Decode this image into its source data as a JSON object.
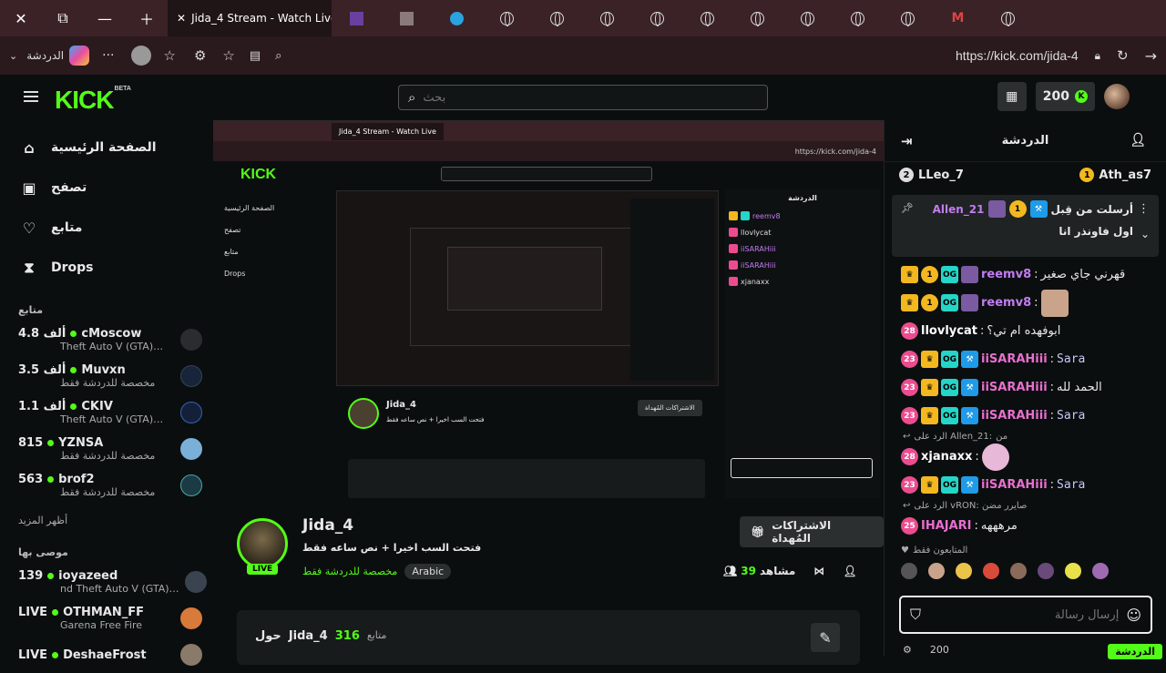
{
  "browser": {
    "active_tab_title": "Jida_4 Stream - Watch Live",
    "url": "https://kick.com/jida-4",
    "chat_label": "الدردشة"
  },
  "header": {
    "logo": "KICK",
    "logo_badge": "BETA",
    "search_placeholder": "بحث",
    "points": "200"
  },
  "sidebar": {
    "nav": [
      {
        "label": "الصفحة الرئيسية",
        "icon": "home-icon"
      },
      {
        "label": "تصفح",
        "icon": "browse-icon"
      },
      {
        "label": "متابع",
        "icon": "heart-icon"
      },
      {
        "label": "Drops",
        "icon": "drops-icon"
      }
    ],
    "following_title": "متابع",
    "following": [
      {
        "count": "4.8 ألف",
        "name": "cMoscow",
        "sub": "Theft Auto V (GTA)…"
      },
      {
        "count": "3.5 ألف",
        "name": "Muvxn",
        "sub": "مخصصة للدردشة فقط"
      },
      {
        "count": "1.1 ألف",
        "name": "CKIV",
        "sub": "Theft Auto V (GTA)…"
      },
      {
        "count": "815",
        "name": "YZNSA",
        "sub": "مخصصة للدردشة فقط"
      },
      {
        "count": "563",
        "name": "brof2",
        "sub": "مخصصة للدردشة فقط"
      }
    ],
    "show_more": "أظهر المزيد",
    "recommended_title": "موصى بها",
    "recommended": [
      {
        "count": "139",
        "name": "ioyazeed",
        "sub": "nd Theft Auto V (GTA)…"
      },
      {
        "count": "LIVE",
        "name": "OTHMAN_FF",
        "sub": "Garena Free Fire"
      },
      {
        "count": "LIVE",
        "name": "DeshaeFrost",
        "sub": ""
      }
    ]
  },
  "stream": {
    "name": "Jida_4",
    "title": "فتحت السب اخيرا + نص ساعه فقط",
    "category": "مخصصة للدردشة فقط",
    "tag": "Arabic",
    "live_label": "LIVE",
    "gift_button": "الاشتراكات المُهداة",
    "viewers": "39",
    "viewers_label": "مشاهد",
    "about_label": "حول",
    "about_name": "Jida_4",
    "followers": "316",
    "followers_label": "متابع"
  },
  "chat": {
    "title": "الدردشة",
    "top_gifters": [
      {
        "rank": "1",
        "name": "Ath_as7"
      },
      {
        "rank": "2",
        "name": "LLeo_7"
      }
    ],
    "pinned_by": "أرسلت من قِبل",
    "pinned_user": "Allen_21",
    "pinned_text": "اول فاونذر انا",
    "messages": [
      {
        "user": "reemv8",
        "text": "قهرني جاي صغير",
        "type": "text"
      },
      {
        "user": "reemv8",
        "text": "",
        "type": "emote"
      },
      {
        "user": "llovlycat",
        "text": "ابوفهده ام تي؟",
        "type": "text",
        "level": "28"
      },
      {
        "user": "iiSARAHiii",
        "text": "Sara",
        "type": "mono",
        "level": "23"
      },
      {
        "user": "iiSARAHiii",
        "text": "الحمد لله",
        "type": "text",
        "level": "23"
      },
      {
        "user": "iiSARAHiii",
        "text": "Sara",
        "type": "mono",
        "level": "23"
      }
    ],
    "reply_1": "الرد على Allen_21:",
    "reply_1_tail": "من",
    "message_xjanaxx": {
      "user": "xjanaxx",
      "level": "28"
    },
    "message_sara3": {
      "user": "iiSARAHiii",
      "text": "Sara",
      "level": "23"
    },
    "reply_2": "الرد على vRON: صايرر مضن",
    "message_ihajari": {
      "user": "IHAJARI",
      "text": "مرهههه",
      "level": "25"
    },
    "subs_only": "المتابعون فقط",
    "input_placeholder": "إرسال رسالة",
    "footer_points": "200",
    "send": "الدردشة"
  },
  "colors": {
    "accent": "#53fc18",
    "background": "#0b0e0f",
    "browser_tab": "#3a2226"
  }
}
